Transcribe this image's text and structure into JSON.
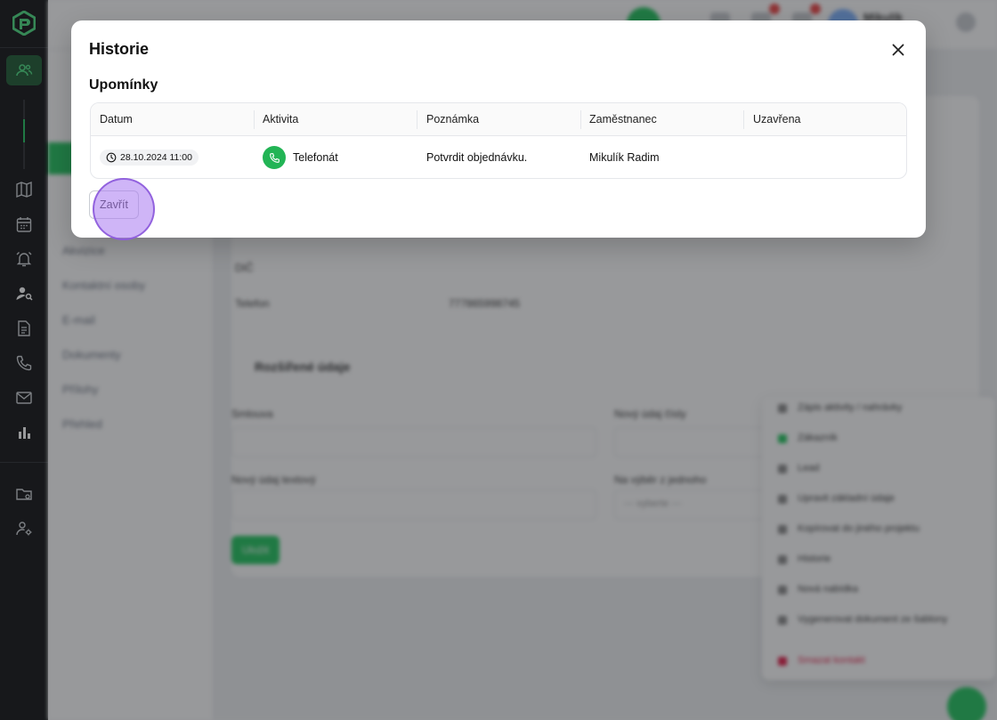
{
  "background": {
    "subnav_items": [
      "Akvizice",
      "Kontaktní osoby",
      "E-mail",
      "Dokumenty",
      "Přílohy",
      "Přehled"
    ],
    "fields": [
      {
        "label": "DIČ",
        "value": ""
      },
      {
        "label": "Telefon",
        "value": "777865998745"
      }
    ],
    "extended_section_title": "Rozšířené údaje",
    "form_labels": [
      "Smlouva",
      "Nový údaj čísly",
      "Nový údaj textový",
      "Na výběr z jednoho"
    ],
    "select_placeholder": "--- vyberte ---",
    "save_label": "Uložit",
    "topbar_user": "Mikulík",
    "menu_items": [
      "Zápis aktivity / nahrávky",
      "Zákazník",
      "Lead",
      "Upravit základní údaje",
      "Kopírovat do jiného projektu",
      "Historie",
      "Nová nabídka",
      "Vygenerovat dokument ze šablony"
    ],
    "menu_delete": "Smazat kontakt"
  },
  "modal": {
    "title": "Historie",
    "section_title": "Upomínky",
    "columns": [
      "Datum",
      "Aktivita",
      "Poznámka",
      "Zaměstnanec",
      "Uzavřena"
    ],
    "rows": [
      {
        "datum": "28.10.2024 11:00",
        "aktivita": "Telefonát",
        "poznamka": "Potvrdit objednávku.",
        "zamestnanec": "Mikulík Radim",
        "uzavrena": ""
      }
    ],
    "close_button_label": "Zavřít"
  },
  "colors": {
    "brand_green": "#22c55e",
    "phone_green": "#22b455",
    "rail_bg": "#111214",
    "click_indicator": "#a878f0"
  }
}
